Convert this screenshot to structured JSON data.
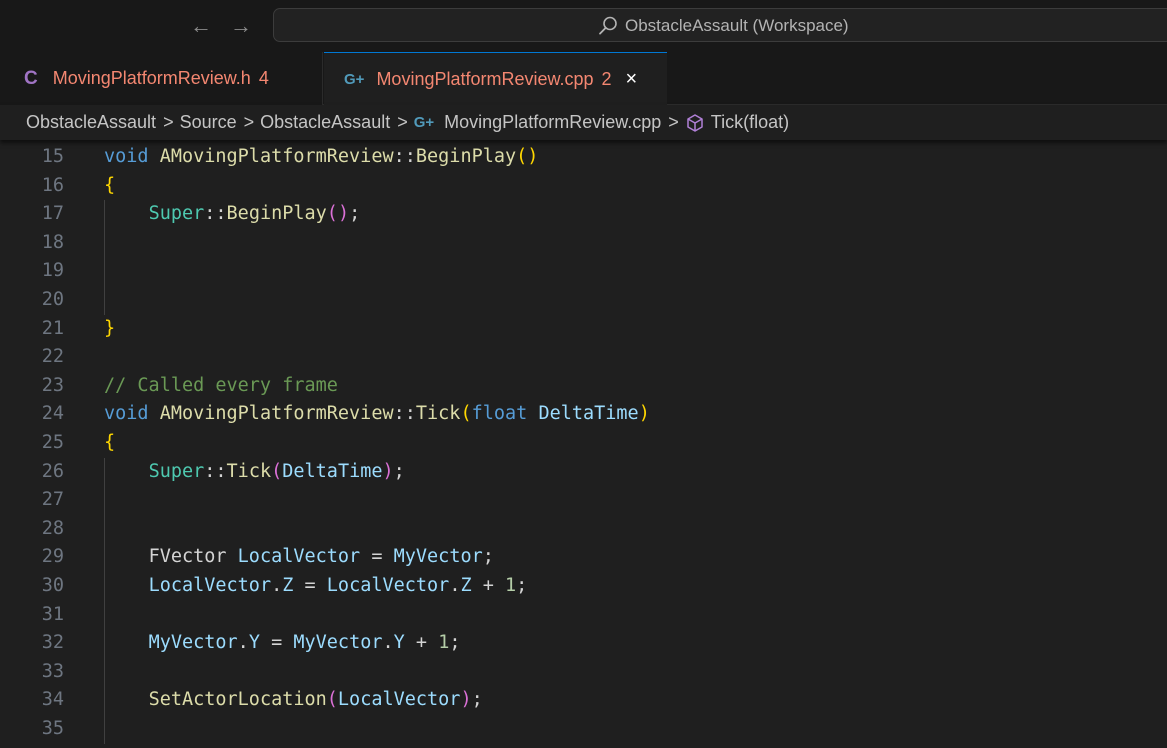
{
  "titlebar": {
    "search_text": "ObstacleAssault (Workspace)",
    "back_glyph": "←",
    "forward_glyph": "→"
  },
  "tabs": [
    {
      "icon": "C",
      "name": "MovingPlatformReview.h",
      "problems": "4",
      "active": false
    },
    {
      "icon": "G+",
      "name": "MovingPlatformReview.cpp",
      "problems": "2",
      "active": true,
      "close": "×"
    }
  ],
  "breadcrumb": {
    "items": [
      "ObstacleAssault",
      "Source",
      "ObstacleAssault",
      "MovingPlatformReview.cpp",
      "Tick(float)"
    ],
    "separator": ">"
  },
  "editor": {
    "lines": [
      {
        "n": "15",
        "t": "void AMovingPlatformReview::BeginPlay()"
      },
      {
        "n": "16",
        "t": "{"
      },
      {
        "n": "17",
        "t": "    Super::BeginPlay();"
      },
      {
        "n": "18",
        "t": ""
      },
      {
        "n": "19",
        "t": ""
      },
      {
        "n": "20",
        "t": ""
      },
      {
        "n": "21",
        "t": "}"
      },
      {
        "n": "22",
        "t": ""
      },
      {
        "n": "23",
        "t": "// Called every frame"
      },
      {
        "n": "24",
        "t": "void AMovingPlatformReview::Tick(float DeltaTime)"
      },
      {
        "n": "25",
        "t": "{"
      },
      {
        "n": "26",
        "t": "    Super::Tick(DeltaTime);"
      },
      {
        "n": "27",
        "t": ""
      },
      {
        "n": "28",
        "t": ""
      },
      {
        "n": "29",
        "t": "    FVector LocalVector = MyVector;"
      },
      {
        "n": "30",
        "t": "    LocalVector.Z = LocalVector.Z + 1;"
      },
      {
        "n": "31",
        "t": ""
      },
      {
        "n": "32",
        "t": "    MyVector.Y = MyVector.Y + 1;"
      },
      {
        "n": "33",
        "t": ""
      },
      {
        "n": "34",
        "t": "    SetActorLocation(LocalVector);"
      },
      {
        "n": "35",
        "t": ""
      }
    ]
  },
  "colors": {
    "tab_error": "#f48771",
    "keyword": "#569cd6",
    "function": "#dcdcaa",
    "type": "#4ec9b0",
    "variable": "#9cdcfe",
    "number": "#b5cea8",
    "comment": "#6a9955",
    "bracket_level1": "#ffd700",
    "bracket_level2": "#da70d6"
  }
}
